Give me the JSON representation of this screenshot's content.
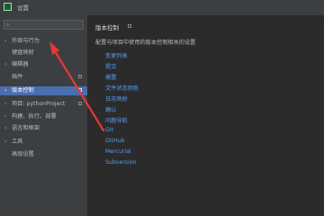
{
  "window": {
    "title": "设置"
  },
  "sidebar": {
    "search_placeholder": "",
    "items": [
      {
        "label": "外观与行为",
        "chevron": "›",
        "has_config": false,
        "selected": false
      },
      {
        "label": "键盘映射",
        "chevron": "",
        "has_config": false,
        "selected": false
      },
      {
        "label": "编辑器",
        "chevron": "›",
        "has_config": false,
        "selected": false
      },
      {
        "label": "插件",
        "chevron": "",
        "has_config": true,
        "selected": false
      },
      {
        "label": "版本控制",
        "chevron": "›",
        "has_config": true,
        "selected": true
      },
      {
        "label": "项目: pythonProject",
        "chevron": "›",
        "has_config": true,
        "selected": false
      },
      {
        "label": "构建、执行、部署",
        "chevron": "›",
        "has_config": false,
        "selected": false
      },
      {
        "label": "语言和框架",
        "chevron": "›",
        "has_config": false,
        "selected": false
      },
      {
        "label": "工具",
        "chevron": "›",
        "has_config": false,
        "selected": false
      },
      {
        "label": "高级设置",
        "chevron": "",
        "has_config": false,
        "selected": false
      }
    ]
  },
  "main": {
    "title": "版本控制",
    "description": "配置与项目中使用的版本控制相关的设置",
    "links": [
      "变更列表",
      "提交",
      "搁置",
      "文件状态颜色",
      "日志映射",
      "确认",
      "问题导航",
      "Git",
      "GitHub",
      "Mercurial",
      "Subversion"
    ]
  },
  "colors": {
    "accent": "#4b6eaf",
    "link": "#589df6",
    "annotation_arrow": "#e53935"
  }
}
